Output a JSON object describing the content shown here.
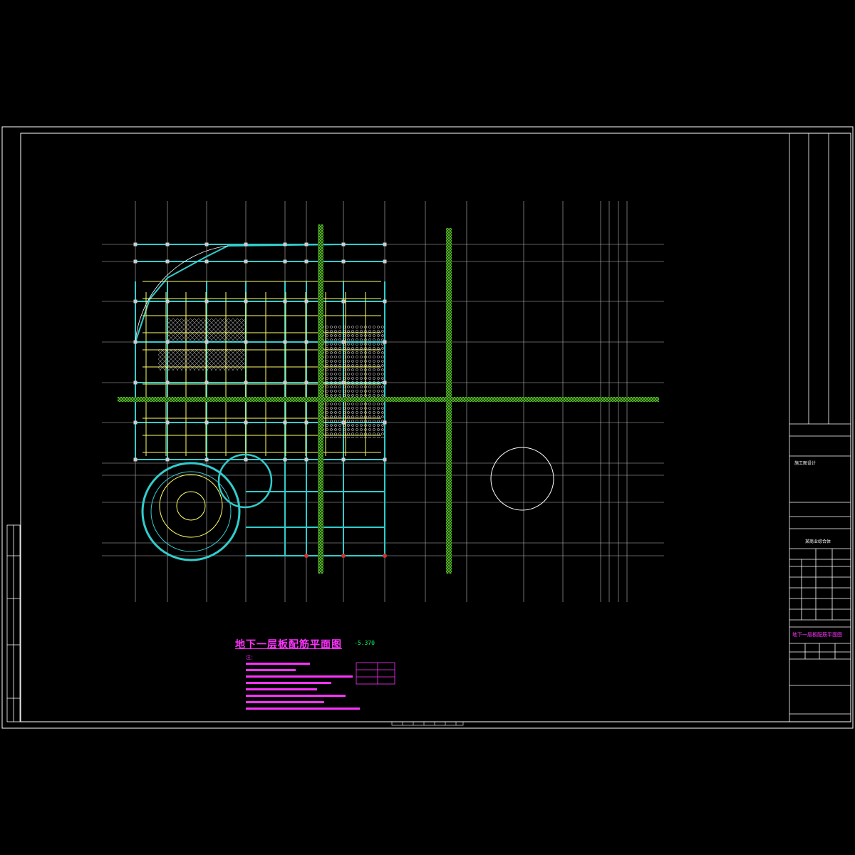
{
  "drawing": {
    "title": "地下一层板配筋平面图",
    "elevation": "-5.370",
    "notes_heading": "注："
  },
  "title_block": {
    "sheet_name": "地下一层板配筋平面图",
    "project_label": "某商业综合体",
    "stage": "施工图设计"
  },
  "colors": {
    "background": "#000000",
    "frame": "#ffffff",
    "grid": "#ffffff",
    "beam": "#33cccc",
    "slab": "#ffff66",
    "rebar": "#66cc33",
    "wall": "#999999",
    "title": "#ff33ff",
    "column": "#cccccc"
  }
}
